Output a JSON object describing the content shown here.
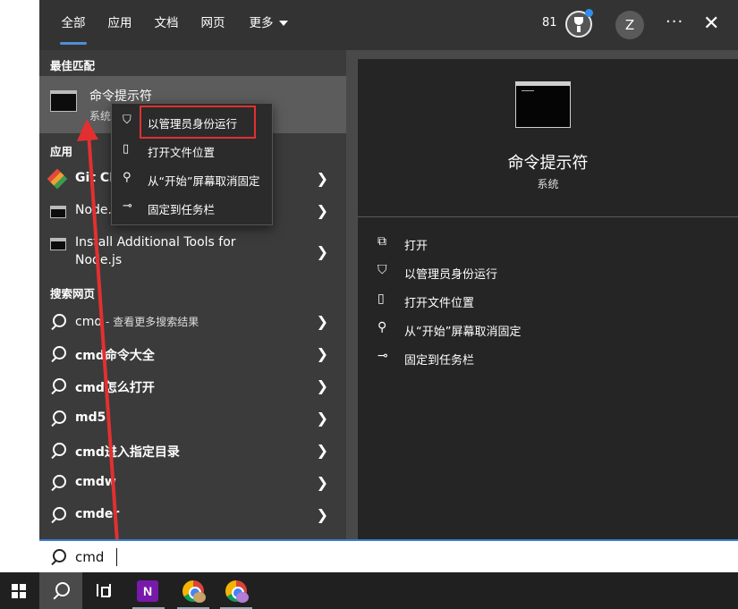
{
  "nav": {
    "tabs": [
      {
        "label": "全部",
        "active": true
      },
      {
        "label": "应用"
      },
      {
        "label": "文档"
      },
      {
        "label": "网页"
      },
      {
        "label": "更多"
      }
    ],
    "points": "81",
    "avatar_letter": "Z",
    "more_glyph": "···",
    "close_glyph": "✕"
  },
  "best_match": {
    "heading": "最佳匹配",
    "title": "命令提示符",
    "subtitle": "系统"
  },
  "apps": {
    "heading": "应用",
    "items": [
      {
        "label": "Git CMD",
        "icon": "git-icon"
      },
      {
        "label": "Node.js",
        "icon": "terminal-icon"
      },
      {
        "label": "Install Additional Tools for",
        "label2": "Node.js",
        "icon": "terminal-icon"
      }
    ]
  },
  "web": {
    "heading": "搜索网页",
    "items": [
      {
        "bold": "cmd",
        "dim": " - 查看更多搜索结果"
      },
      {
        "bold": "cmd命令大全"
      },
      {
        "bold": "cmd怎么打开"
      },
      {
        "bold": "md5"
      },
      {
        "bold": "cmd进入指定目录"
      },
      {
        "bold": "cmdw"
      },
      {
        "bold": "cmder"
      }
    ]
  },
  "context_menu": {
    "items": [
      {
        "label": "以管理员身份运行",
        "icon": "shield-icon"
      },
      {
        "label": "打开文件位置",
        "icon": "file-location-icon"
      },
      {
        "label": "从“开始”屏幕取消固定",
        "icon": "unpin-icon"
      },
      {
        "label": "固定到任务栏",
        "icon": "pin-icon"
      }
    ]
  },
  "detail": {
    "title": "命令提示符",
    "subtitle": "系统",
    "actions": [
      {
        "label": "打开",
        "icon": "open-icon"
      },
      {
        "label": "以管理员身份运行",
        "icon": "shield-icon"
      },
      {
        "label": "打开文件位置",
        "icon": "file-location-icon"
      },
      {
        "label": "从“开始”屏幕取消固定",
        "icon": "unpin-icon"
      },
      {
        "label": "固定到任务栏",
        "icon": "pin-icon"
      }
    ]
  },
  "search": {
    "value": "cmd"
  },
  "taskbar": {
    "onenote_letter": "N"
  },
  "colors": {
    "highlight_box": "#e23030",
    "annotation_arrow": "#e23030",
    "nav_accent": "#4f8fd6"
  }
}
